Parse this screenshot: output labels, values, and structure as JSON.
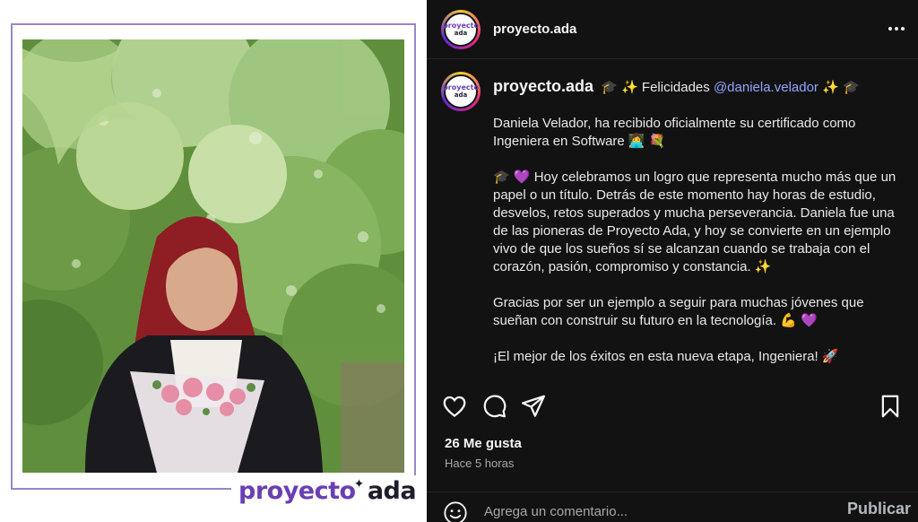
{
  "post_image": {
    "brand_part1": "proyecto",
    "brand_part2": "ada",
    "colors": {
      "brand_purple": "#6a3fb2",
      "brand_dark": "#1d1d2b",
      "frame": "#9a86c9"
    }
  },
  "header": {
    "username": "proyecto.ada",
    "avatar_line1": "proyecto",
    "avatar_line2": "ada",
    "more_icon": "more-horizontal-icon"
  },
  "caption": {
    "username": "proyecto.ada",
    "title_prefix": "🎓 ✨ Felicidades",
    "mention": "@daniela.velador",
    "title_suffix": "✨ 🎓",
    "paragraphs": [
      "Daniela Velador, ha recibido oficialmente su certificado como Ingeniera en Software 👩‍💻 💐",
      "🎓 💜 Hoy celebramos un logro que representa mucho más que un papel o un título. Detrás de este momento hay horas de estudio, desvelos, retos superados y mucha perseverancia. Daniela fue una de las pioneras de Proyecto Ada, y hoy se convierte en un ejemplo vivo de que los sueños sí se alcanzan cuando se trabaja con el corazón, pasión, compromiso y constancia. ✨",
      "Gracias por ser un ejemplo a seguir para muchas jóvenes que sueñan con construir su futuro en la tecnología. 💪 💜",
      "¡El mejor de los éxitos en esta nueva etapa, Ingeniera! 🚀"
    ]
  },
  "actions": {
    "like_icon": "heart-icon",
    "comment_icon": "comment-icon",
    "share_icon": "send-icon",
    "save_icon": "bookmark-icon"
  },
  "likes": "26 Me gusta",
  "timestamp": "Hace 5 horas",
  "comment_box": {
    "placeholder": "Agrega un comentario...",
    "publish_label": "Publicar",
    "emoji_icon": "emoji-icon"
  },
  "theme": {
    "panel_bg": "#121212",
    "mention_color": "#8fa7ff",
    "muted": "#a8a8a8"
  }
}
